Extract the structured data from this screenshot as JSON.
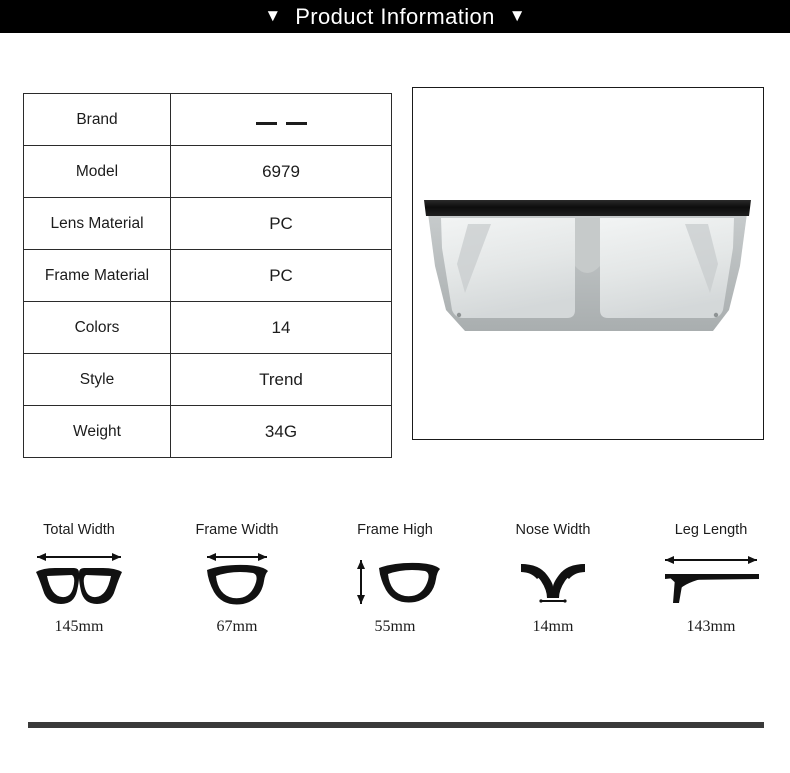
{
  "header": {
    "left_marker": "▼",
    "title": "Product Information",
    "right_marker": "▼",
    "background_color": "#000000",
    "text_color": "#ffffff"
  },
  "spec_table": {
    "rows": [
      {
        "key": "Brand",
        "value": "— —",
        "value_is_dashes": true
      },
      {
        "key": "Model",
        "value": "6979"
      },
      {
        "key": "Lens Material",
        "value": "PC"
      },
      {
        "key": "Frame Material",
        "value": "PC"
      },
      {
        "key": "Colors",
        "value": "14"
      },
      {
        "key": "Style",
        "value": "Trend"
      },
      {
        "key": "Weight",
        "value": "34G"
      }
    ]
  },
  "product_image": {
    "alt": "flat-top shield sunglasses, black top bar with silver mirrored lens",
    "frame_color": "#b9bdbe",
    "lens_color": "#e8eaea",
    "top_bar_color": "#141414"
  },
  "measurements": [
    {
      "label": "Total Width",
      "value": "145mm",
      "icon": "full-frame-horizontal-arrow-icon"
    },
    {
      "label": "Frame Width",
      "value": "67mm",
      "icon": "single-lens-horizontal-arrow-icon"
    },
    {
      "label": "Frame High",
      "value": "55mm",
      "icon": "single-lens-vertical-arrow-icon"
    },
    {
      "label": "Nose Width",
      "value": "14mm",
      "icon": "nose-bridge-icon"
    },
    {
      "label": "Leg Length",
      "value": "143mm",
      "icon": "temple-arm-horizontal-arrow-icon"
    }
  ],
  "divider": {
    "color": "#3a3a3a"
  }
}
